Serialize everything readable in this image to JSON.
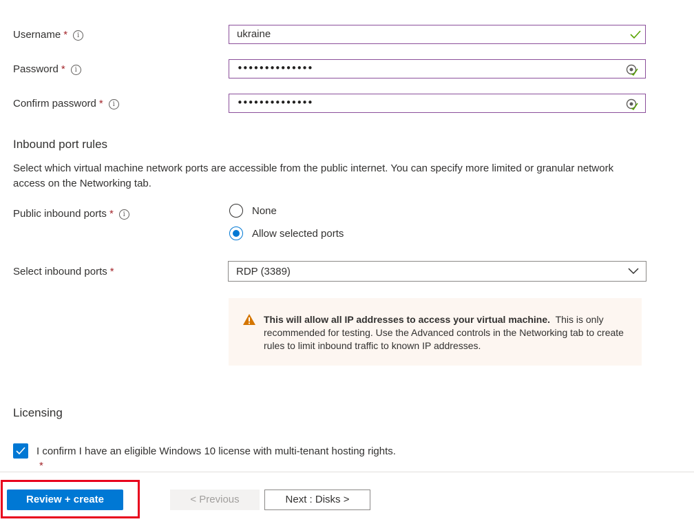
{
  "fields": {
    "username": {
      "label": "Username",
      "value": "ukraine"
    },
    "password": {
      "label": "Password",
      "value": "••••••••••••••"
    },
    "confirm_password": {
      "label": "Confirm password",
      "value": "••••••••••••••"
    },
    "required_mark": "*",
    "info_glyph": "i"
  },
  "inbound": {
    "title": "Inbound port rules",
    "description": "Select which virtual machine network ports are accessible from the public internet. You can specify more limited or granular network access on the Networking tab.",
    "public_ports_label": "Public inbound ports",
    "options": [
      "None",
      "Allow selected ports"
    ],
    "selected_option": "Allow selected ports",
    "select_ports_label": "Select inbound ports",
    "select_ports_value": "RDP (3389)",
    "warning_bold": "This will allow all IP addresses to access your virtual machine.",
    "warning_text": "This is only recommended for testing.  Use the Advanced controls in the Networking tab to create rules to limit inbound traffic to known IP addresses."
  },
  "licensing": {
    "title": "Licensing",
    "confirm_text": "I confirm I have an eligible Windows 10 license with multi-tenant hosting rights.",
    "checked": true
  },
  "footer": {
    "review_create": "Review + create",
    "previous": "< Previous",
    "next": "Next : Disks >"
  },
  "colors": {
    "accent": "#0078d4",
    "required": "#a4262c",
    "field_border": "#8a4e9a",
    "valid_check": "#57a300",
    "warning_icon": "#d47500",
    "highlight": "#e8001c"
  },
  "icons": [
    "info-icon",
    "checkmark-icon",
    "password-reveal-icon",
    "chevron-down-icon",
    "warning-icon",
    "check-icon"
  ]
}
